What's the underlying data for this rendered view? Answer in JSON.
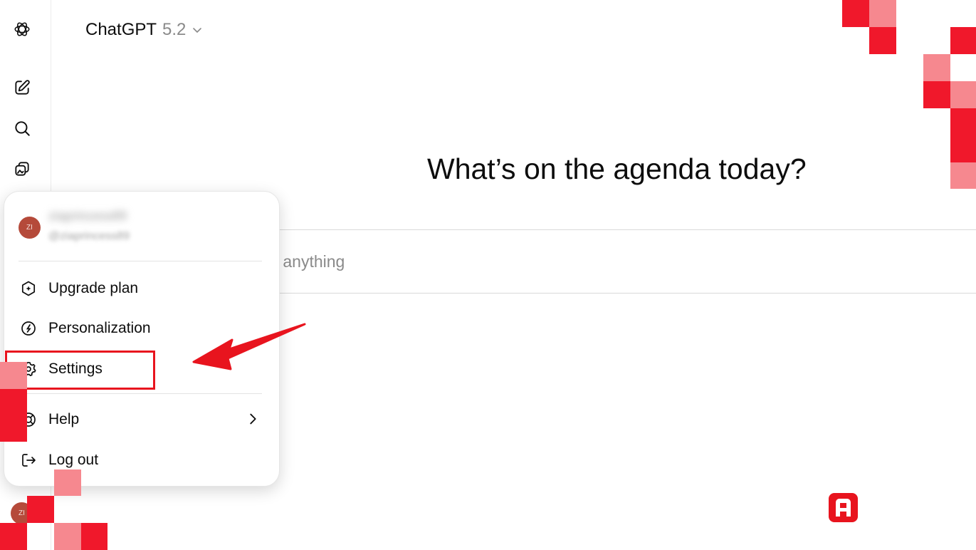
{
  "header": {
    "model_name": "ChatGPT",
    "model_version": "5.2",
    "model_dropdown_icon": "chevron-down-icon"
  },
  "sidebar": {
    "items": [
      {
        "name": "openai-logo-icon"
      },
      {
        "name": "new-chat-icon"
      },
      {
        "name": "search-icon"
      },
      {
        "name": "library-icon"
      }
    ],
    "user_avatar_initials": "ZI"
  },
  "main": {
    "headline": "What’s on the agenda today?",
    "composer_placeholder": "sk anything"
  },
  "account_menu": {
    "avatar_initials": "ZI",
    "profile_name": "ziaprincess89",
    "profile_handle": "@ziaprincess89",
    "items": [
      {
        "label": "Upgrade plan",
        "icon": "upgrade-icon"
      },
      {
        "label": "Personalization",
        "icon": "personalization-icon"
      },
      {
        "label": "Settings",
        "icon": "gear-icon"
      },
      {
        "label": "Help",
        "icon": "help-icon",
        "has_submenu": true
      },
      {
        "label": "Log out",
        "icon": "logout-icon"
      }
    ]
  },
  "annotation": {
    "highlight_color": "#e8141e",
    "arrow_color": "#e8141e",
    "highlighted_item": "Settings"
  },
  "colors": {
    "pixel_dark": "#f0182b",
    "pixel_light": "#f6888f",
    "brand_badge": "#e8141e"
  }
}
